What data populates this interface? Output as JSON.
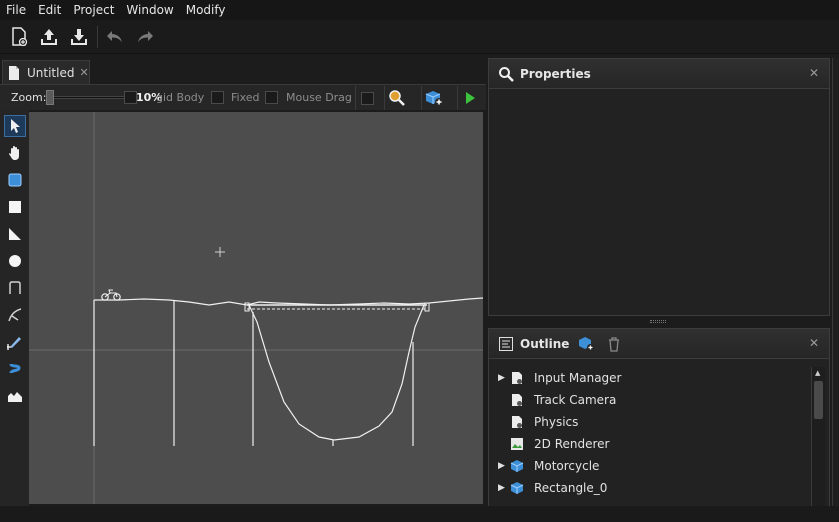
{
  "menubar": {
    "items": [
      "File",
      "Edit",
      "Project",
      "Window",
      "Modify"
    ]
  },
  "toolbar": {
    "icons": [
      "new-file-icon",
      "upload-icon",
      "download-icon",
      "undo-icon",
      "redo-icon"
    ]
  },
  "document_tab": {
    "title": "Untitled",
    "close_glyph": "✕"
  },
  "view_options": {
    "zoom_label": "Zoom:",
    "zoom_value": "10%",
    "rigid_body_label": "gid Body",
    "fixed_label": "Fixed",
    "mouse_drag_label": "Mouse Drag"
  },
  "tools": [
    "select-tool",
    "pan-tool",
    "box-select-tool",
    "rectangle-tool",
    "triangle-tool",
    "circle-tool",
    "path-tool",
    "joint-tool",
    "pen-tool",
    "spring-tool",
    "terrain-tool"
  ],
  "properties_panel": {
    "title": "Properties",
    "close_glyph": "✕"
  },
  "outline_panel": {
    "title": "Outline",
    "close_glyph": "✕",
    "items": [
      {
        "label": "Input Manager",
        "expandable": true,
        "icon": "document-gear-icon"
      },
      {
        "label": "Track Camera",
        "expandable": false,
        "icon": "document-gear-icon"
      },
      {
        "label": "Physics",
        "expandable": false,
        "icon": "document-gear-icon"
      },
      {
        "label": "2D Renderer",
        "expandable": false,
        "icon": "image-icon"
      },
      {
        "label": "Motorcycle",
        "expandable": true,
        "icon": "cube-icon"
      },
      {
        "label": "Rectangle_0",
        "expandable": true,
        "icon": "cube-icon"
      }
    ]
  },
  "colors": {
    "accent_blue": "#3d8fd8",
    "play_green": "#3cc23c",
    "canvas_bg": "#4d4d4d"
  }
}
